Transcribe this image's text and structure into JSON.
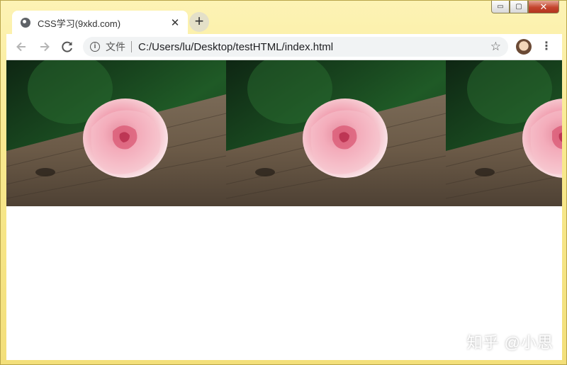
{
  "window": {
    "caption_buttons": {
      "minimize": "▭",
      "maximize": "▢",
      "close": "✕"
    }
  },
  "tab": {
    "title": "CSS学习(9xkd.com)",
    "close": "✕",
    "icon": "globe-icon"
  },
  "new_tab": "+",
  "toolbar": {
    "back_icon": "arrow-left-icon",
    "forward_icon": "arrow-right-icon",
    "reload_icon": "reload-icon",
    "info": "i",
    "scheme_label": "文件",
    "url": "C:/Users/lu/Desktop/testHTML/index.html",
    "star": "☆",
    "menu": "⋮"
  },
  "page": {
    "background_image": "rose-on-wood",
    "repeat": "repeat-x"
  },
  "watermark": "知乎 @小思",
  "colors": {
    "frame": "#f8e98f",
    "omnibox": "#f1f3f4",
    "rose": "#f0a9b6",
    "wood": "#6e5a45",
    "foliage": "#1f5a26"
  }
}
